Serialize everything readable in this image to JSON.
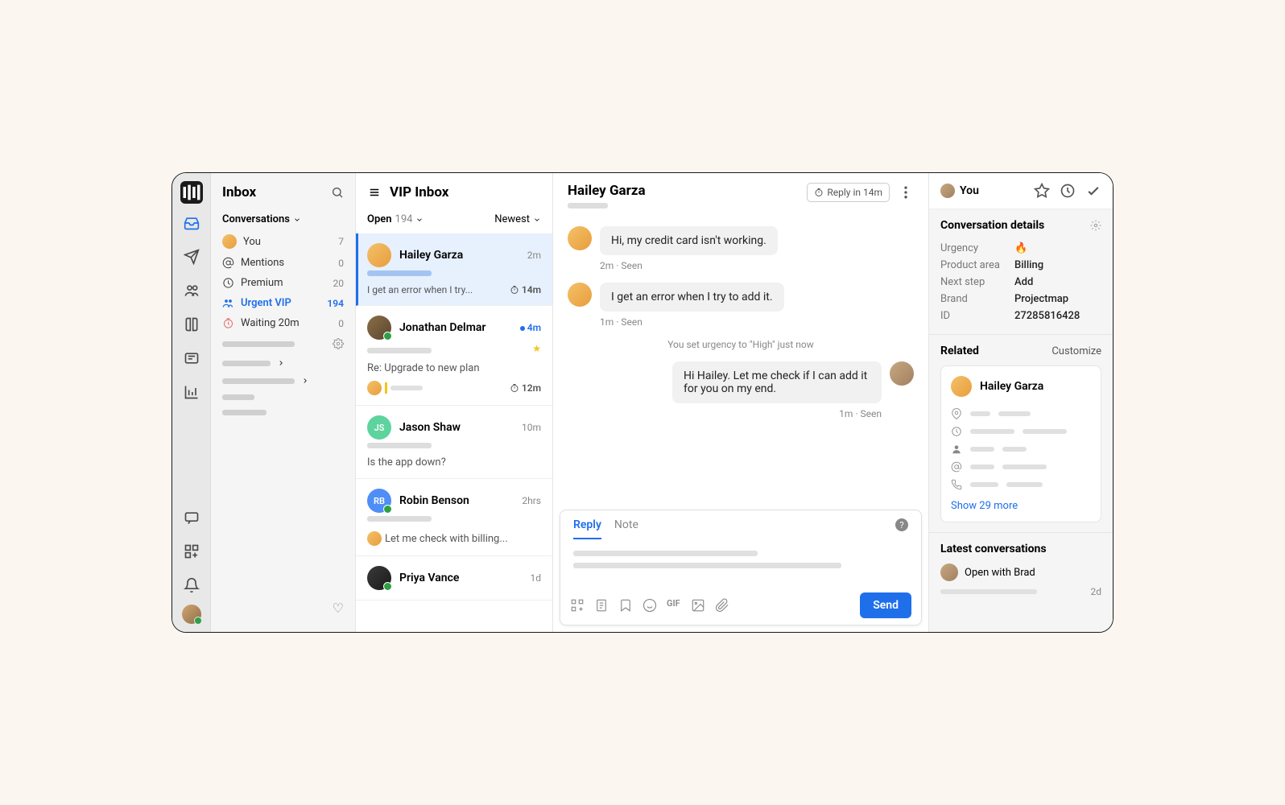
{
  "sidebar": {
    "title": "Inbox",
    "section": "Conversations",
    "items": [
      {
        "label": "You",
        "count": "7"
      },
      {
        "label": "Mentions",
        "count": "0"
      },
      {
        "label": "Premium",
        "count": "20"
      },
      {
        "label": "Urgent VIP",
        "count": "194"
      },
      {
        "label": "Waiting 20m",
        "count": "0"
      }
    ]
  },
  "list": {
    "title": "VIP Inbox",
    "filter_status": "Open",
    "filter_count": "194",
    "sort": "Newest",
    "cards": [
      {
        "name": "Hailey Garza",
        "time": "2m",
        "preview": "I get an error when I try...",
        "timer": "14m"
      },
      {
        "name": "Jonathan Delmar",
        "time": "4m",
        "preview": "Re: Upgrade to new plan",
        "timer": "12m"
      },
      {
        "name": "Jason Shaw",
        "initials": "JS",
        "time": "10m",
        "preview": "Is the app down?"
      },
      {
        "name": "Robin Benson",
        "initials": "RB",
        "time": "2hrs",
        "preview": "Let me check with billing..."
      },
      {
        "name": "Priya Vance",
        "time": "1d"
      }
    ]
  },
  "conversation": {
    "name": "Hailey Garza",
    "reply_badge": "Reply in 14m",
    "messages": [
      {
        "text": "Hi, my credit card isn't working.",
        "meta": "2m · Seen"
      },
      {
        "text": "I get an error when I try to add it.",
        "meta": "1m · Seen"
      }
    ],
    "system": "You set urgency to \"High\" just now",
    "reply": {
      "text": "Hi Hailey. Let me check if I can add it for you on my end.",
      "meta": "1m · Seen"
    },
    "tabs": {
      "reply": "Reply",
      "note": "Note"
    },
    "send": "Send"
  },
  "details": {
    "you": "You",
    "title": "Conversation details",
    "urgency_label": "Urgency",
    "urgency": "🔥",
    "product_label": "Product area",
    "product": "Billing",
    "nextstep_label": "Next step",
    "nextstep": "Add",
    "brand_label": "Brand",
    "brand": "Projectmap",
    "id_label": "ID",
    "id": "27285816428",
    "related_label": "Related",
    "customize": "Customize",
    "related_name": "Hailey Garza",
    "show_more": "Show 29 more",
    "latest_title": "Latest conversations",
    "latest_text": "Open with Brad",
    "latest_time": "2d"
  }
}
